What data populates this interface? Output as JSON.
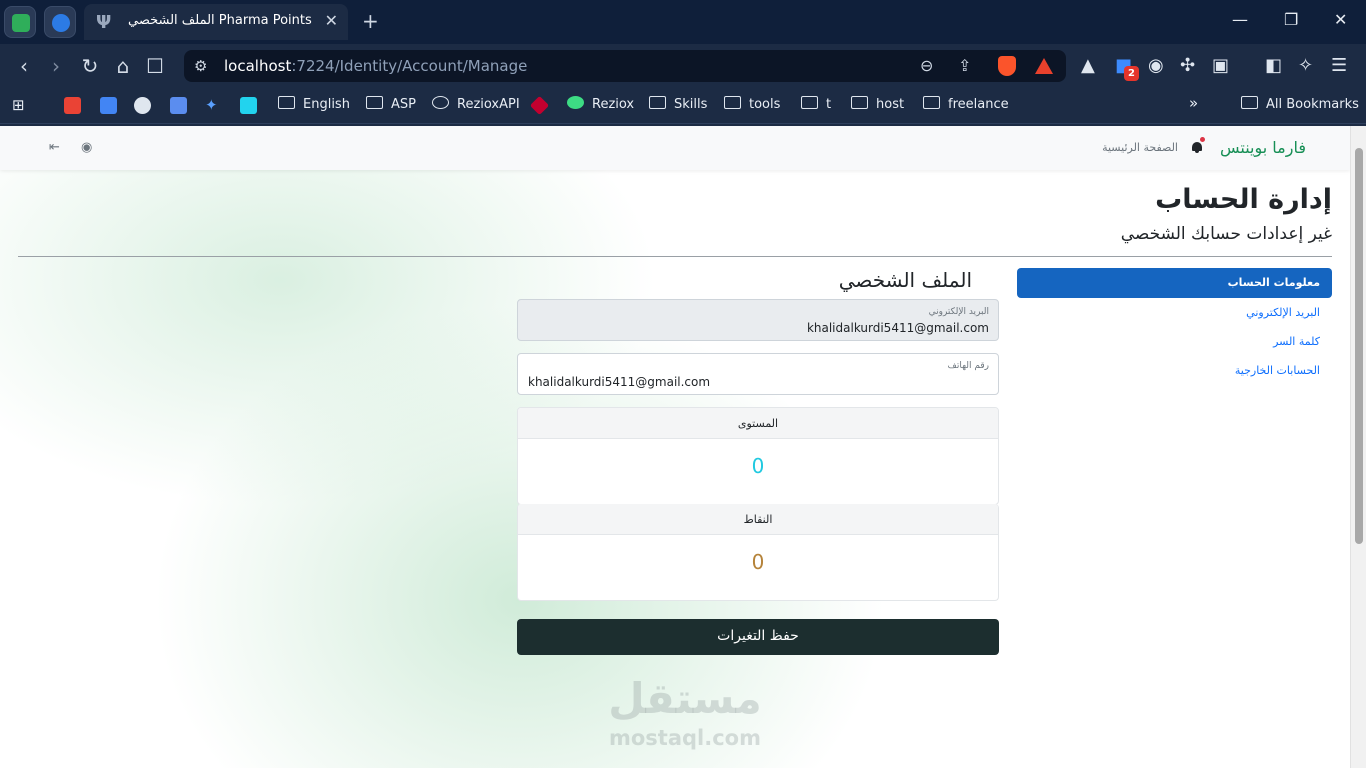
{
  "browser": {
    "tab_title": "الملف الشخصي Pharma Points",
    "url_host": "localhost",
    "url_rest": ":7224/Identity/Account/Manage",
    "ext_badge": "2",
    "bookmarks": [
      "English",
      "ASP",
      "RezioxAPI",
      "Reziox",
      "Skills",
      "tools",
      "t",
      "host",
      "freelance"
    ],
    "all_bookmarks": "All Bookmarks",
    "overflow": "»"
  },
  "app": {
    "brand": "فارما بوينتس",
    "home": "الصفحة الرئيسية"
  },
  "manage": {
    "title": "إدارة الحساب",
    "subtitle": "غير إعدادات حسابك الشخصي",
    "nav": [
      "معلومات الحساب",
      "البريد الإلكتروني",
      "كلمة السر",
      "الحسابات الخارجية"
    ]
  },
  "profile": {
    "heading": "الملف الشخصي",
    "email_label": "البريد الإلكتروني",
    "email_value": "khalidalkurdi5411@gmail.com",
    "phone_label": "رقم الهاتف",
    "phone_value": "khalidalkurdi5411@gmail.com",
    "level_label": "المستوى",
    "level_value": "0",
    "points_label": "النقاط",
    "points_value": "0",
    "save": "حفظ التغيرات"
  },
  "colors": {
    "brand": "#178f55",
    "level": "#20c9e0",
    "points": "#b5833a",
    "active_nav": "#1565c0",
    "save_button": "#1c2e2f"
  },
  "watermark": {
    "ar": "مستقل",
    "en": "mostaql.com"
  }
}
